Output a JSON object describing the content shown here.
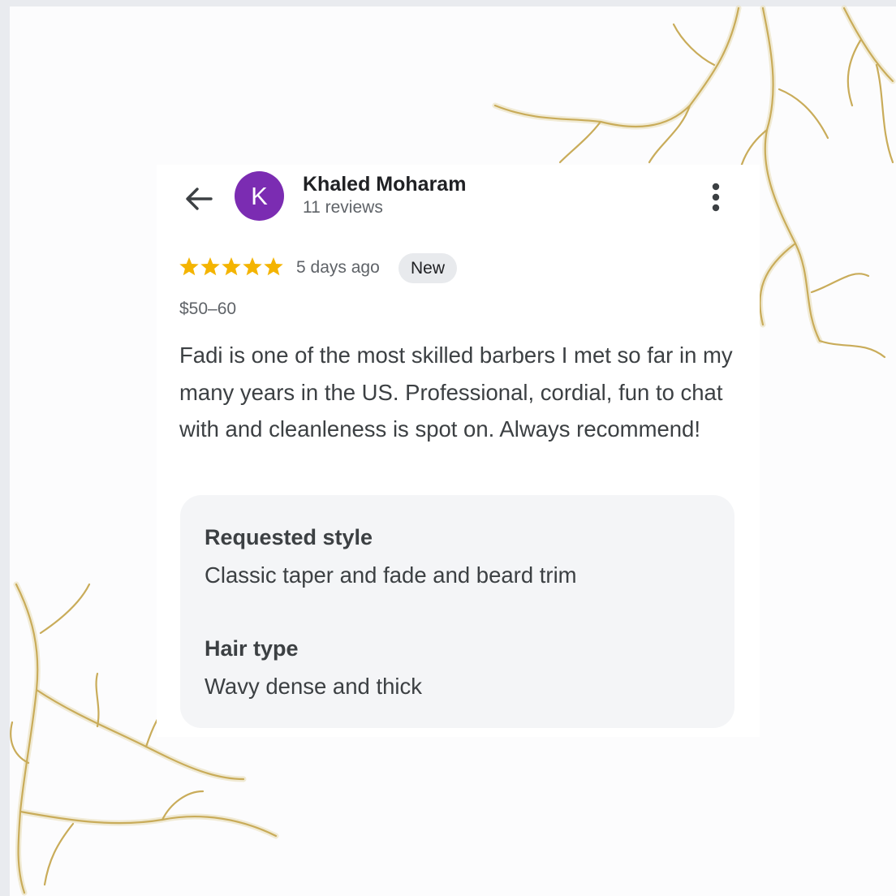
{
  "reviewer": {
    "initial": "K",
    "name": "Khaled Moharam",
    "review_count": "11 reviews"
  },
  "review": {
    "rating": 5,
    "date": "5 days ago",
    "badge": "New",
    "price": "$50–60",
    "text": "Fadi is one of the most skilled barbers I met so far in my many years in the US. Professional, cordial, fun to chat with and cleanleness is spot on. Always recommend!"
  },
  "attributes": [
    {
      "label": "Requested style",
      "value": "Classic taper and fade and beard trim"
    },
    {
      "label": "Hair type",
      "value": "Wavy dense and thick"
    }
  ],
  "icons": {
    "back": "arrow-left-icon",
    "more": "more-vertical-icon",
    "star": "star-icon"
  },
  "colors": {
    "avatar": "#7b2cb2",
    "star": "#f4b400",
    "decoration": "#c9ac5a"
  }
}
